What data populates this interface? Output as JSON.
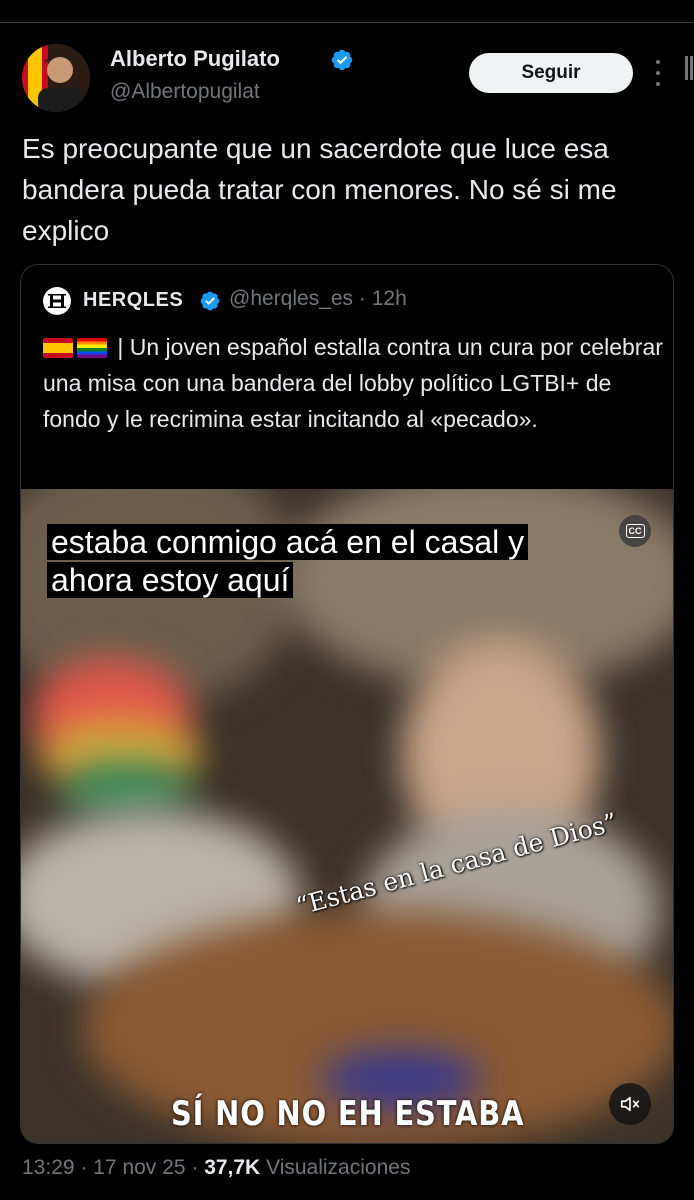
{
  "tweet": {
    "author_name": "Alberto Pugilato",
    "author_handle": "@Albertopugilat",
    "follow_label": "Seguir",
    "text": "Es preocupante que un sacerdote que luce esa bandera pueda tratar con menores. No sé si me explico",
    "time": "13:29",
    "date": "17 nov 25",
    "views_count": "37,7K",
    "views_label": "Visualizaciones",
    "separator": "·"
  },
  "quote": {
    "name": "HERQLES",
    "handle": "@herqles_es",
    "age": "12h",
    "separator": "·",
    "text": "| Un joven español estalla contra un cura por celebrar una misa con una bandera del lobby político LGTBI+ de fondo y le recrimina estar incitando al «pecado».",
    "flags": [
      "spain-flag",
      "pride-flag"
    ],
    "video": {
      "caption_line1": "estaba conmigo acá en el casal y",
      "caption_line2": "ahora estoy aquí",
      "cc_label": "CC",
      "overlay_text": "“Estas en la casa de Dios”",
      "bottom_text": "SÍ NO NO EH ESTABA"
    }
  },
  "colors": {
    "background": "#000000",
    "text": "#e7e9ea",
    "muted": "#71767b",
    "border": "#2f3336",
    "verified": "#1d9bf0",
    "follow_bg": "#eff3f4"
  },
  "icons": [
    "verified-badge-icon",
    "more-options-icon",
    "cc-icon",
    "mute-icon"
  ]
}
